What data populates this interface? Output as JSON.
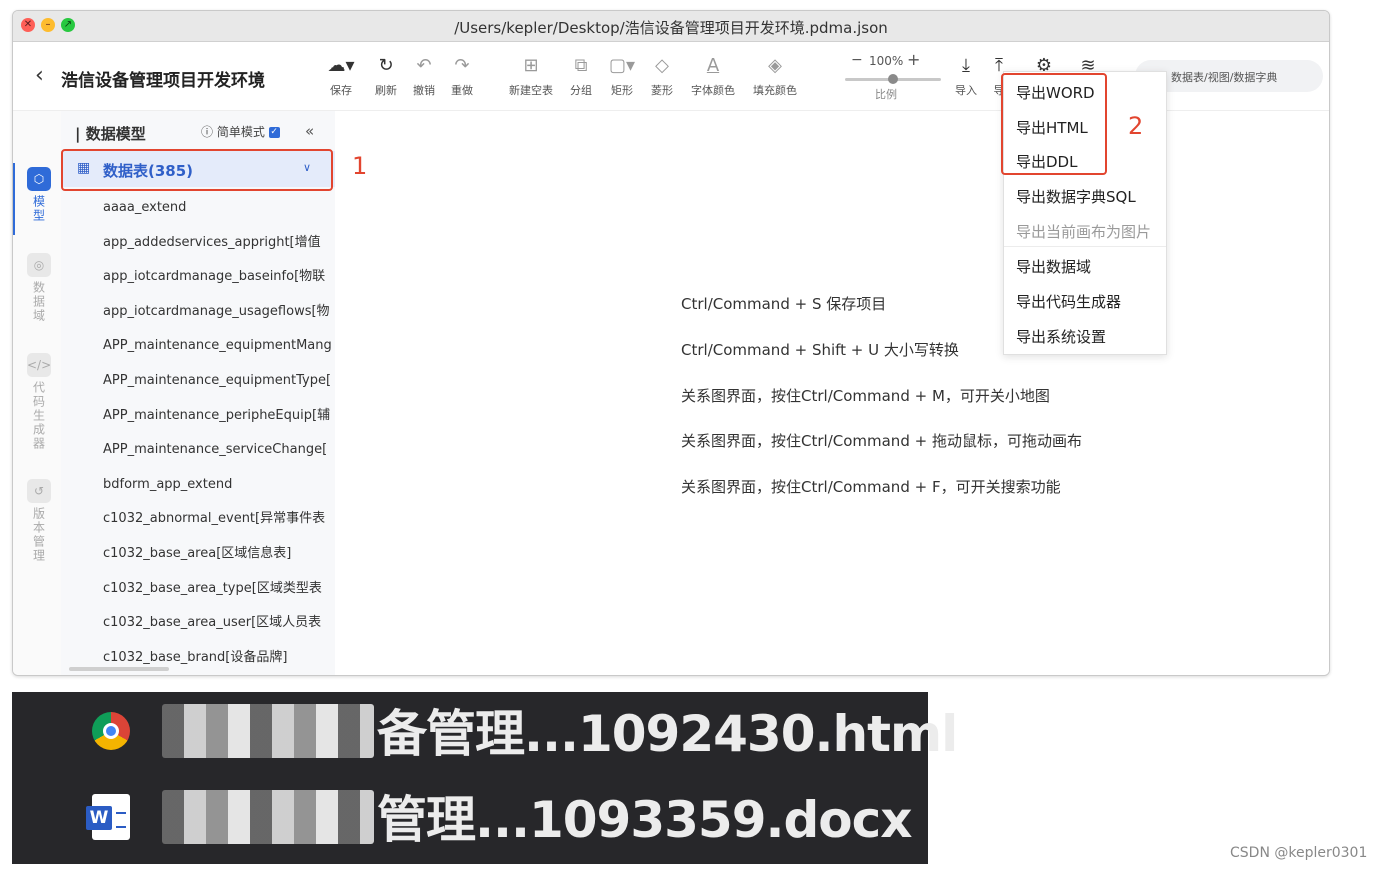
{
  "window": {
    "title": "/Users/kepler/Desktop/浩信设备管理项目开发环境.pdma.json"
  },
  "header": {
    "back_icon": "chevron-left",
    "project_name": "浩信设备管理项目开发环境"
  },
  "toolbar": {
    "tools": [
      {
        "icon": "save-icon",
        "glyph": "☁▾",
        "label": "保存"
      },
      {
        "icon": "refresh-icon",
        "glyph": "↻",
        "label": "刷新"
      },
      {
        "icon": "undo-icon",
        "glyph": "↶",
        "label": "撤销"
      },
      {
        "icon": "redo-icon",
        "glyph": "↷",
        "label": "重做"
      },
      {
        "icon": "new-table-icon",
        "glyph": "⊞",
        "label": "新建空表"
      },
      {
        "icon": "group-icon",
        "glyph": "⧉",
        "label": "分组"
      },
      {
        "icon": "rectangle-icon",
        "glyph": "▢▾",
        "label": "矩形"
      },
      {
        "icon": "diamond-icon",
        "glyph": "◇",
        "label": "菱形"
      },
      {
        "icon": "font-color-icon",
        "glyph": "A",
        "label": "字体颜色"
      },
      {
        "icon": "fill-color-icon",
        "glyph": "◈",
        "label": "填充颜色"
      }
    ],
    "zoom": {
      "minus": "−",
      "value": "100%",
      "plus": "+",
      "label": "比例",
      "level": 0.5
    },
    "import": {
      "glyph": "⤓",
      "label": "导入"
    },
    "export": {
      "glyph": "⤒",
      "label": "导"
    },
    "settings_glyph": "⚙",
    "db_glyph": "≋",
    "search_placeholder": "数据表/视图/数据字典"
  },
  "rail": [
    {
      "label": "模型",
      "active": true
    },
    {
      "label": "数据域",
      "active": false
    },
    {
      "label": "代码生成器",
      "active": false
    },
    {
      "label": "版本管理",
      "active": false
    }
  ],
  "sidebar": {
    "title": "| 数据模型",
    "simple_mode": "简单模式",
    "simple_mode_checked": true,
    "collapse_glyph": "«",
    "tables_label": "数据表(385)",
    "tables": [
      "aaaa_extend",
      "app_addedservices_appright[增值",
      "app_iotcardmanage_baseinfo[物联",
      "app_iotcardmanage_usageflows[物",
      "APP_maintenance_equipmentMang",
      "APP_maintenance_equipmentType[",
      "APP_maintenance_peripheEquip[辅",
      "APP_maintenance_serviceChange[",
      "bdform_app_extend",
      "c1032_abnormal_event[异常事件表",
      "c1032_base_area[区域信息表]",
      "c1032_base_area_type[区域类型表",
      "c1032_base_area_user[区域人员表",
      "c1032_base_brand[设备品牌]"
    ]
  },
  "canvas": {
    "tips": [
      "Ctrl/Command + S 保存项目",
      "Ctrl/Command + Shift + U 大小写转换",
      "关系图界面，按住Ctrl/Command + M，可开关小地图",
      "关系图界面，按住Ctrl/Command + 拖动鼠标，可拖动画布",
      "关系图界面，按住Ctrl/Command + F，可开关搜索功能"
    ]
  },
  "export_menu": {
    "items": [
      {
        "label": "导出WORD",
        "disabled": false
      },
      {
        "label": "导出HTML",
        "disabled": false
      },
      {
        "label": "导出DDL",
        "disabled": false
      },
      {
        "label": "导出数据字典SQL",
        "disabled": false
      },
      {
        "label": "导出当前画布为图片",
        "disabled": true
      },
      {
        "label": "导出数据域",
        "disabled": false
      },
      {
        "label": "导出代码生成器",
        "disabled": false
      },
      {
        "label": "导出系统设置",
        "disabled": false
      }
    ]
  },
  "annotations": {
    "one": "1",
    "two": "2",
    "color": "#e2452f"
  },
  "downloads": [
    {
      "icon": "chrome-icon",
      "name_visible": "备管理...1092430.html"
    },
    {
      "icon": "word-icon",
      "name_visible": "管理...1093359.docx"
    }
  ],
  "credit": "CSDN @kepler0301"
}
